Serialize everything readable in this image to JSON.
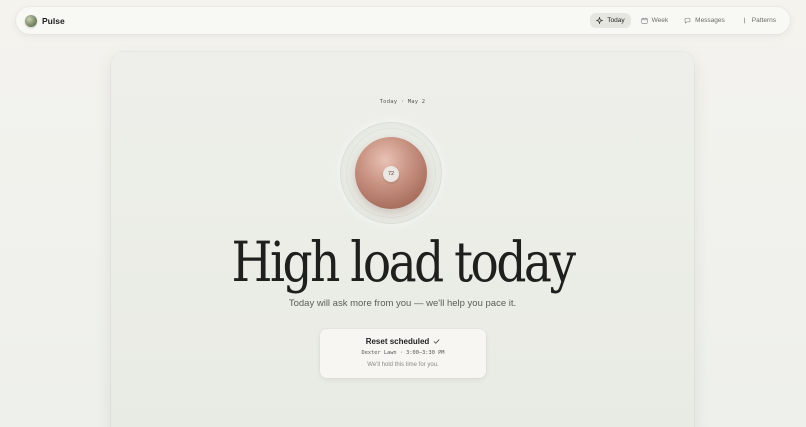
{
  "app": {
    "name": "Pulse"
  },
  "nav": [
    {
      "label": "Today",
      "icon": "sparkle-icon",
      "active": true
    },
    {
      "label": "Week",
      "icon": "calendar-icon",
      "active": false
    },
    {
      "label": "Messages",
      "icon": "chat-icon",
      "active": false
    },
    {
      "label": "Patterns",
      "icon": "pattern-icon",
      "active": false
    }
  ],
  "main": {
    "date": "Today · May 2",
    "load_value": "72",
    "headline": "High load today",
    "subline": "Today will ask more from you — we'll help you pace it.",
    "reset": {
      "title": "Reset scheduled",
      "detail": "Dexter Lawn · 3:00–3:30 PM",
      "note": "We'll hold this time for you."
    }
  },
  "colors": {
    "orb": "#c08a7a",
    "accent_text": "#1f1f1d",
    "background": "#f1f2ed"
  }
}
